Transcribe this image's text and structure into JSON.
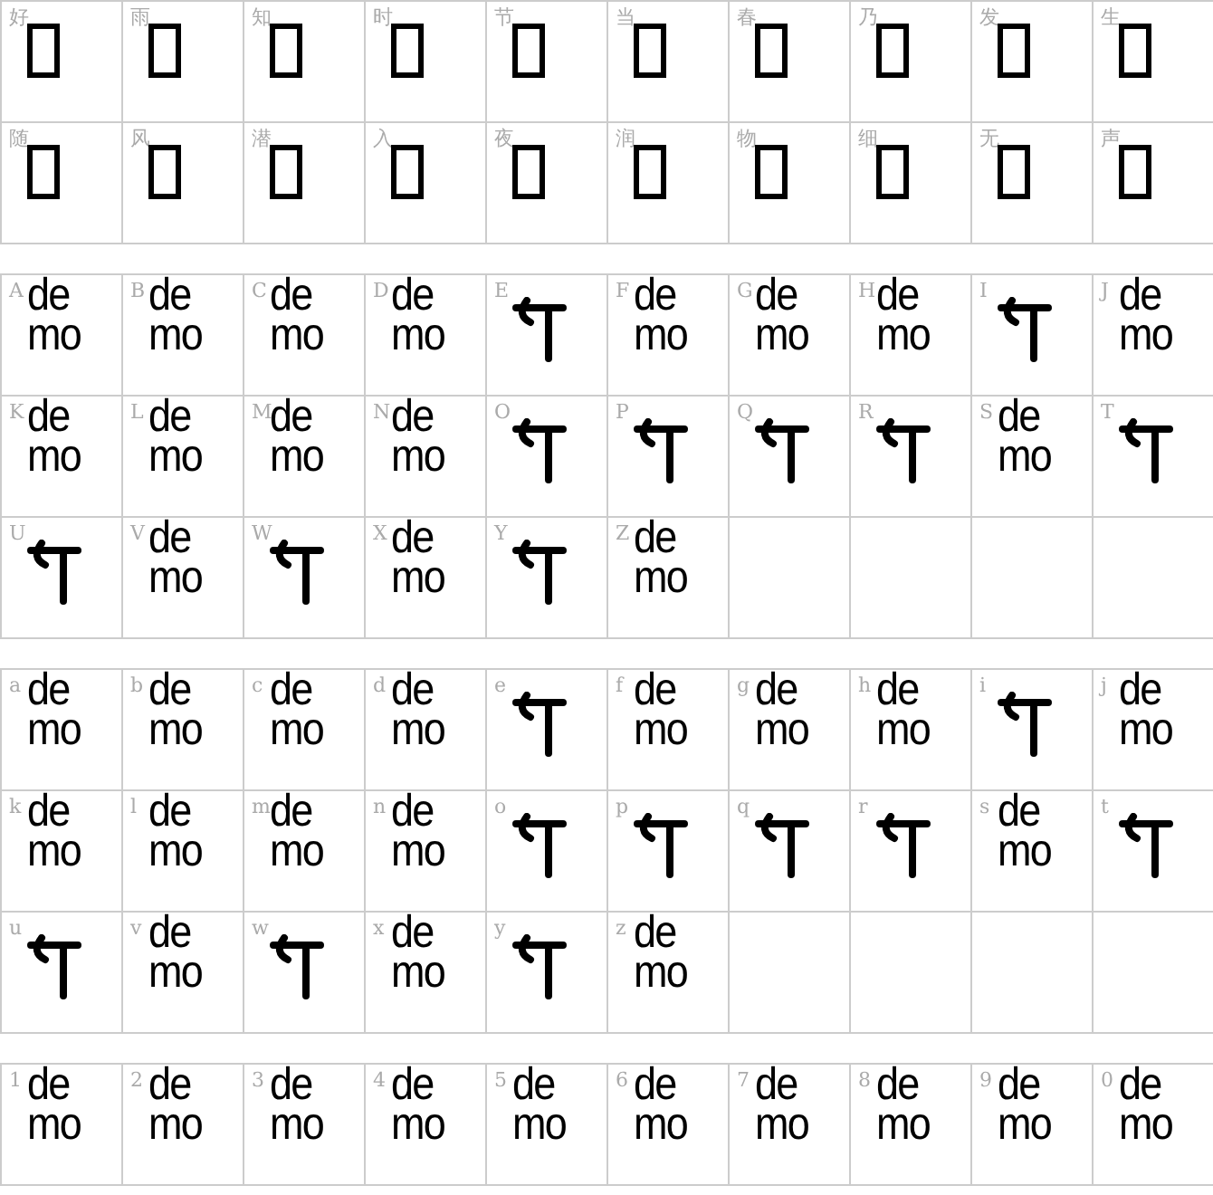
{
  "sections": [
    {
      "rows": [
        [
          {
            "label": "好",
            "kind": "missing"
          },
          {
            "label": "雨",
            "kind": "missing"
          },
          {
            "label": "知",
            "kind": "missing"
          },
          {
            "label": "时",
            "kind": "missing"
          },
          {
            "label": "节",
            "kind": "missing"
          },
          {
            "label": "当",
            "kind": "missing"
          },
          {
            "label": "春",
            "kind": "missing"
          },
          {
            "label": "乃",
            "kind": "missing"
          },
          {
            "label": "发",
            "kind": "missing"
          },
          {
            "label": "生",
            "kind": "missing"
          }
        ],
        [
          {
            "label": "随",
            "kind": "missing"
          },
          {
            "label": "风",
            "kind": "missing"
          },
          {
            "label": "潜",
            "kind": "missing"
          },
          {
            "label": "入",
            "kind": "missing"
          },
          {
            "label": "夜",
            "kind": "missing"
          },
          {
            "label": "润",
            "kind": "missing"
          },
          {
            "label": "物",
            "kind": "missing"
          },
          {
            "label": "细",
            "kind": "missing"
          },
          {
            "label": "无",
            "kind": "missing"
          },
          {
            "label": "声",
            "kind": "missing"
          }
        ]
      ]
    },
    {
      "rows": [
        [
          {
            "label": "A",
            "kind": "demo",
            "text": "demo"
          },
          {
            "label": "B",
            "kind": "demo",
            "text": "demo"
          },
          {
            "label": "C",
            "kind": "demo",
            "text": "demo"
          },
          {
            "label": "D",
            "kind": "demo",
            "text": "demo"
          },
          {
            "label": "E",
            "kind": "glyph"
          },
          {
            "label": "F",
            "kind": "demo",
            "text": "demo"
          },
          {
            "label": "G",
            "kind": "demo",
            "text": "demo"
          },
          {
            "label": "H",
            "kind": "demo",
            "text": "demo"
          },
          {
            "label": "I",
            "kind": "glyph"
          },
          {
            "label": "J",
            "kind": "demo",
            "text": "demo"
          }
        ],
        [
          {
            "label": "K",
            "kind": "demo",
            "text": "demo"
          },
          {
            "label": "L",
            "kind": "demo",
            "text": "demo"
          },
          {
            "label": "M",
            "kind": "demo",
            "text": "demo"
          },
          {
            "label": "N",
            "kind": "demo",
            "text": "demo"
          },
          {
            "label": "O",
            "kind": "glyph"
          },
          {
            "label": "P",
            "kind": "glyph"
          },
          {
            "label": "Q",
            "kind": "glyph"
          },
          {
            "label": "R",
            "kind": "glyph"
          },
          {
            "label": "S",
            "kind": "demo",
            "text": "demo"
          },
          {
            "label": "T",
            "kind": "glyph"
          }
        ],
        [
          {
            "label": "U",
            "kind": "glyph"
          },
          {
            "label": "V",
            "kind": "demo",
            "text": "demo"
          },
          {
            "label": "W",
            "kind": "glyph"
          },
          {
            "label": "X",
            "kind": "demo",
            "text": "demo"
          },
          {
            "label": "Y",
            "kind": "glyph"
          },
          {
            "label": "Z",
            "kind": "demo",
            "text": "demo"
          },
          {
            "kind": "empty"
          },
          {
            "kind": "empty"
          },
          {
            "kind": "empty"
          },
          {
            "kind": "empty"
          }
        ]
      ]
    },
    {
      "rows": [
        [
          {
            "label": "a",
            "kind": "demo",
            "text": "demo"
          },
          {
            "label": "b",
            "kind": "demo",
            "text": "demo"
          },
          {
            "label": "c",
            "kind": "demo",
            "text": "demo"
          },
          {
            "label": "d",
            "kind": "demo",
            "text": "demo"
          },
          {
            "label": "e",
            "kind": "glyph"
          },
          {
            "label": "f",
            "kind": "demo",
            "text": "demo"
          },
          {
            "label": "g",
            "kind": "demo",
            "text": "demo"
          },
          {
            "label": "h",
            "kind": "demo",
            "text": "demo"
          },
          {
            "label": "i",
            "kind": "glyph"
          },
          {
            "label": "j",
            "kind": "demo",
            "text": "demo"
          }
        ],
        [
          {
            "label": "k",
            "kind": "demo",
            "text": "demo"
          },
          {
            "label": "l",
            "kind": "demo",
            "text": "demo"
          },
          {
            "label": "m",
            "kind": "demo",
            "text": "demo"
          },
          {
            "label": "n",
            "kind": "demo",
            "text": "demo"
          },
          {
            "label": "o",
            "kind": "glyph"
          },
          {
            "label": "p",
            "kind": "glyph"
          },
          {
            "label": "q",
            "kind": "glyph"
          },
          {
            "label": "r",
            "kind": "glyph"
          },
          {
            "label": "s",
            "kind": "demo",
            "text": "demo"
          },
          {
            "label": "t",
            "kind": "glyph"
          }
        ],
        [
          {
            "label": "u",
            "kind": "glyph"
          },
          {
            "label": "v",
            "kind": "demo",
            "text": "demo"
          },
          {
            "label": "w",
            "kind": "glyph"
          },
          {
            "label": "x",
            "kind": "demo",
            "text": "demo"
          },
          {
            "label": "y",
            "kind": "glyph"
          },
          {
            "label": "z",
            "kind": "demo",
            "text": "demo"
          },
          {
            "kind": "empty"
          },
          {
            "kind": "empty"
          },
          {
            "kind": "empty"
          },
          {
            "kind": "empty"
          }
        ]
      ]
    },
    {
      "rows": [
        [
          {
            "label": "1",
            "kind": "demo",
            "text": "demo"
          },
          {
            "label": "2",
            "kind": "demo",
            "text": "demo"
          },
          {
            "label": "3",
            "kind": "demo",
            "text": "demo"
          },
          {
            "label": "4",
            "kind": "demo",
            "text": "demo"
          },
          {
            "label": "5",
            "kind": "demo",
            "text": "demo"
          },
          {
            "label": "6",
            "kind": "demo",
            "text": "demo"
          },
          {
            "label": "7",
            "kind": "demo",
            "text": "demo"
          },
          {
            "label": "8",
            "kind": "demo",
            "text": "demo"
          },
          {
            "label": "9",
            "kind": "demo",
            "text": "demo"
          },
          {
            "label": "0",
            "kind": "demo",
            "text": "demo"
          }
        ]
      ]
    }
  ]
}
